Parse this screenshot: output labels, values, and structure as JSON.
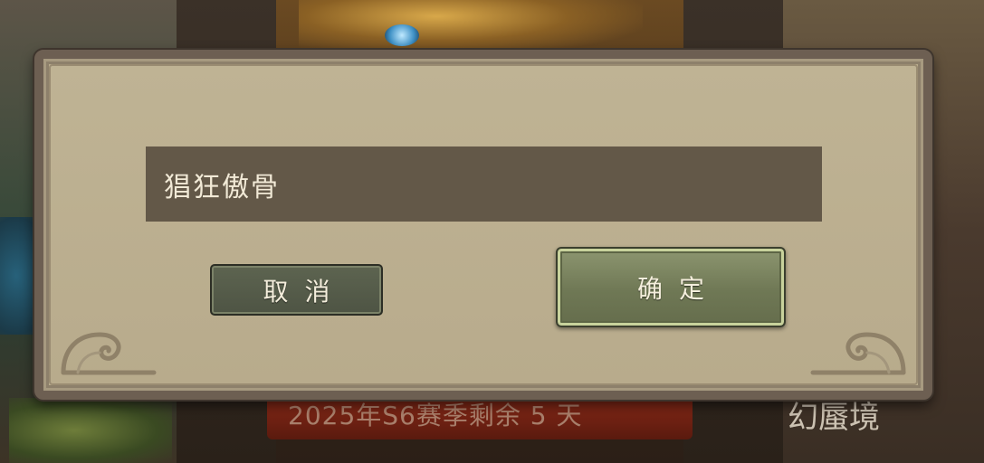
{
  "background": {
    "banner_text": "2025年S6赛季剩余 5 天",
    "side_calligraphy": "幻蜃境"
  },
  "dialog": {
    "name_value": "猖狂傲骨",
    "cancel_label": "取消",
    "confirm_label": "确定"
  },
  "icons": {
    "corner_left": "cloud-scroll-ornament-icon",
    "corner_right": "cloud-scroll-ornament-icon"
  },
  "colors": {
    "dialog_bg": "#bbae8f",
    "dialog_frame": "#6d5f52",
    "field_bg": "#635848",
    "cancel_bg": "#545b49",
    "confirm_bg": "#7a8360",
    "text_light": "#f4eedc"
  }
}
